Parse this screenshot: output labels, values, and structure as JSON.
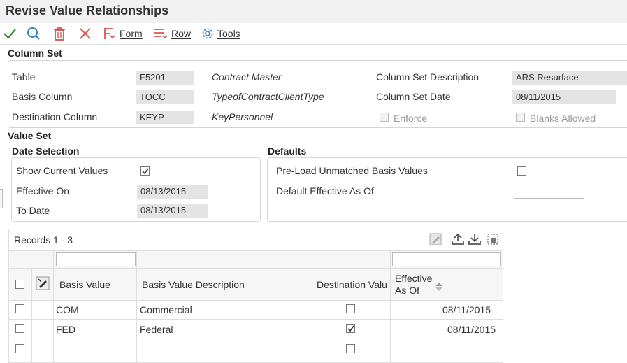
{
  "page": {
    "title": "Revise Value Relationships"
  },
  "toolbar": {
    "form_label": "Form",
    "row_label": "Row",
    "tools_label": "Tools"
  },
  "column_set": {
    "title": "Column Set",
    "table_label": "Table",
    "table_value": "F5201",
    "table_desc": "Contract Master",
    "basis_label": "Basis Column",
    "basis_value": "TOCC",
    "basis_desc": "TypeofContractClientType",
    "dest_label": "Destination Column",
    "dest_value": "KEYP",
    "dest_desc": "KeyPersonnel",
    "csdesc_label": "Column Set Description",
    "csdesc_value": "ARS Resurface",
    "csdate_label": "Column Set Date",
    "csdate_value": "08/11/2015",
    "enforce_label": "Enforce",
    "enforce_checked": false,
    "blanks_label": "Blanks Allowed",
    "blanks_checked": false
  },
  "value_set": {
    "title": "Value Set",
    "date_selection": {
      "title": "Date Selection",
      "show_current_label": "Show Current Values",
      "show_current_checked": true,
      "effective_on_label": "Effective On",
      "effective_on_value": "08/13/2015",
      "to_date_label": "To Date",
      "to_date_value": "08/13/2015"
    },
    "defaults": {
      "title": "Defaults",
      "preload_label": "Pre-Load Unmatched Basis Values",
      "preload_checked": false,
      "default_eff_label": "Default Effective As Of",
      "default_eff_value": ""
    }
  },
  "grid": {
    "records_label": "Records 1 - 3",
    "columns": {
      "basis_value": "Basis Value",
      "basis_desc": "Basis Value Description",
      "dest_value": "Destination Valu",
      "effective_line1": "Effective",
      "effective_line2": "As Of"
    },
    "rows": [
      {
        "basis_value": "COM",
        "basis_desc": "Commercial",
        "dest_checked": false,
        "effective": "08/11/2015"
      },
      {
        "basis_value": "FED",
        "basis_desc": "Federal",
        "dest_checked": true,
        "effective": "08/11/2015"
      },
      {
        "basis_value": "",
        "basis_desc": "",
        "dest_checked": false,
        "effective": ""
      }
    ]
  },
  "colors": {
    "check_green": "#2e8b2e",
    "delete_red": "#d9534f",
    "icon_blue": "#3a7fc4",
    "title_bg": "#f1f1f1"
  }
}
